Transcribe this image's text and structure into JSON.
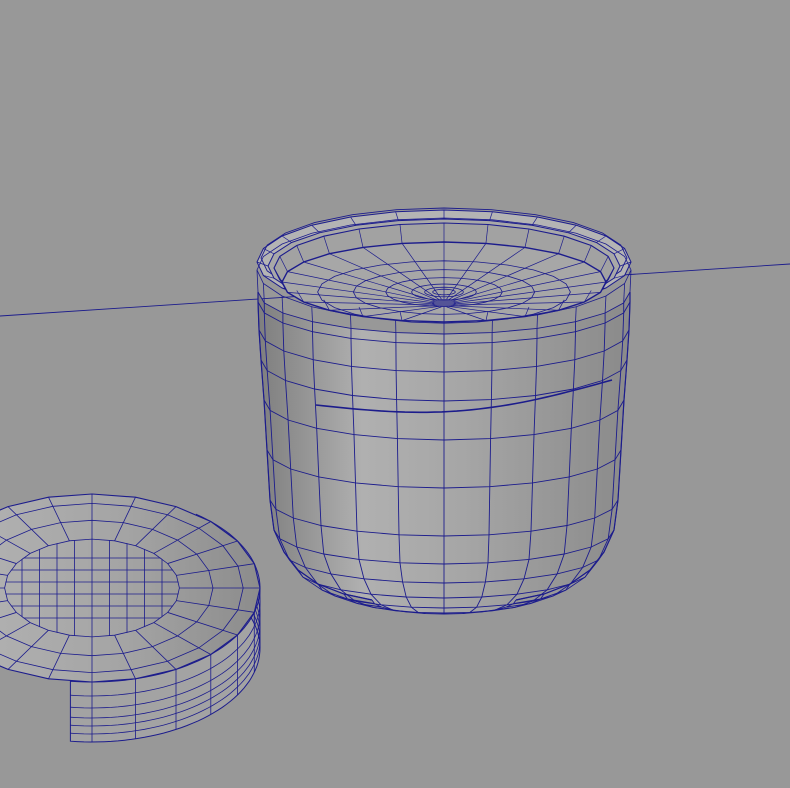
{
  "viewport": {
    "background_color": "#989898",
    "wire_color": "#1c1c8c"
  },
  "scene": {
    "objects": [
      {
        "id": "cup-body",
        "kind": "wireframe-mesh",
        "shape": "cup"
      },
      {
        "id": "cup-lid",
        "kind": "wireframe-mesh",
        "shape": "lid"
      }
    ],
    "guides": [
      {
        "id": "ground-horizon-line",
        "kind": "grid-line"
      }
    ]
  }
}
